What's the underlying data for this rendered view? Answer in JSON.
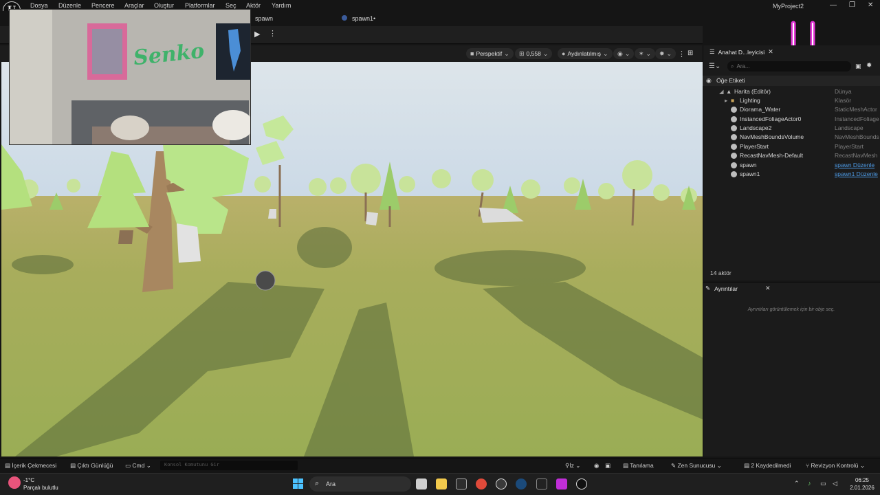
{
  "menu": {
    "items": [
      "Dosya",
      "Düzenle",
      "Pencere",
      "Araçlar",
      "Oluştur",
      "Platformlar",
      "Seç",
      "Aktör",
      "Yardım"
    ],
    "project_title": "MyProject2"
  },
  "tabs": {
    "level_tab": "spawn",
    "level_tab2": "spawn1•"
  },
  "viewport": {
    "perspective_label": "Perspektif",
    "speed_value": "0,558",
    "lighting_label": "Aydınlatılmış"
  },
  "outliner": {
    "tab_title": "Anahat D...leyicisi",
    "search_placeholder": "Ara...",
    "column_label": "Öğe Etiketi",
    "items": [
      {
        "name": "Harita (Editör)",
        "type": "Dünya"
      },
      {
        "name": "Lighting",
        "type": "Klasör"
      },
      {
        "name": "Diorama_Water",
        "type": "StaticMeshActor"
      },
      {
        "name": "InstancedFoliageActor0",
        "type": "InstancedFoliage"
      },
      {
        "name": "Landscape2",
        "type": "Landscape"
      },
      {
        "name": "NavMeshBoundsVolume",
        "type": "NavMeshBounds"
      },
      {
        "name": "PlayerStart",
        "type": "PlayerStart"
      },
      {
        "name": "RecastNavMesh-Default",
        "type": "RecastNavMesh"
      },
      {
        "name": "spawn",
        "type": "spawn Düzenle"
      },
      {
        "name": "spawn1",
        "type": "spawn1 Düzenle"
      }
    ],
    "actor_count": "14 aktör"
  },
  "details": {
    "tab_title": "Ayrıntılar",
    "hint": "Ayrıntıları görüntülemek için bir obje seç."
  },
  "statusbar": {
    "content_drawer": "İçerik Çekmecesi",
    "output_log": "Çıktı Günlüğü",
    "cmd": "Cmd",
    "console_placeholder": "Konsol Komutunu Gir",
    "iz": "İz",
    "tanilama": "Tanılama",
    "zen": "Zen Sunucusu",
    "saved": "2 Kaydedilmedi",
    "revision": "Revizyon Kontrolü"
  },
  "taskbar": {
    "temperature": "-1°C",
    "weather": "Parçalı bulutlu",
    "search_label": "Ara",
    "time": "06:25",
    "date": "2.01.2026"
  },
  "webcam": {
    "wall_text": "Senko"
  },
  "colors": {
    "editor_bg": "#151515",
    "panel_bg": "#1b1b1b",
    "link": "#4d9be6",
    "sky": "#d9e3ea",
    "grass": "#a9b55e",
    "overlay_pink": "#e436d8"
  }
}
